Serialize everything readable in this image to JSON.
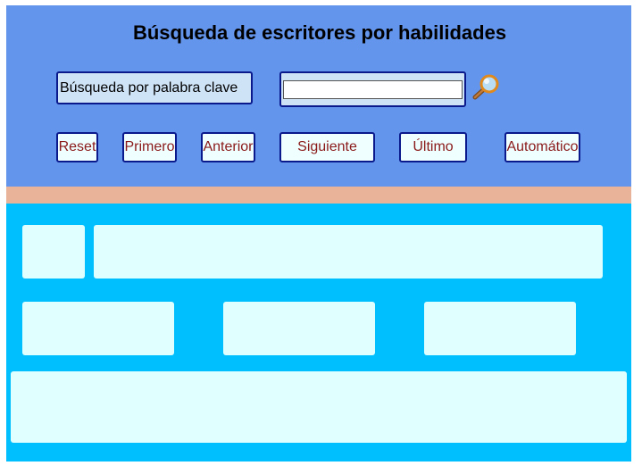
{
  "header": {
    "title": "Búsqueda de escritores por habilidades"
  },
  "search": {
    "label": "Búsqueda por palabra clave",
    "value": "",
    "icon": "magnifier-icon"
  },
  "nav": {
    "reset": "Reset",
    "first": "Primero",
    "previous": "Anterior",
    "next": "Siguiente",
    "last": "Último",
    "auto": "Automático"
  },
  "colors": {
    "top_panel": "#6495ED",
    "divider": "#E9B39A",
    "bottom_panel": "#00BFFF",
    "field": "#E0FFFF",
    "button_text": "#8B1A1A",
    "border": "#0A1A8C"
  }
}
